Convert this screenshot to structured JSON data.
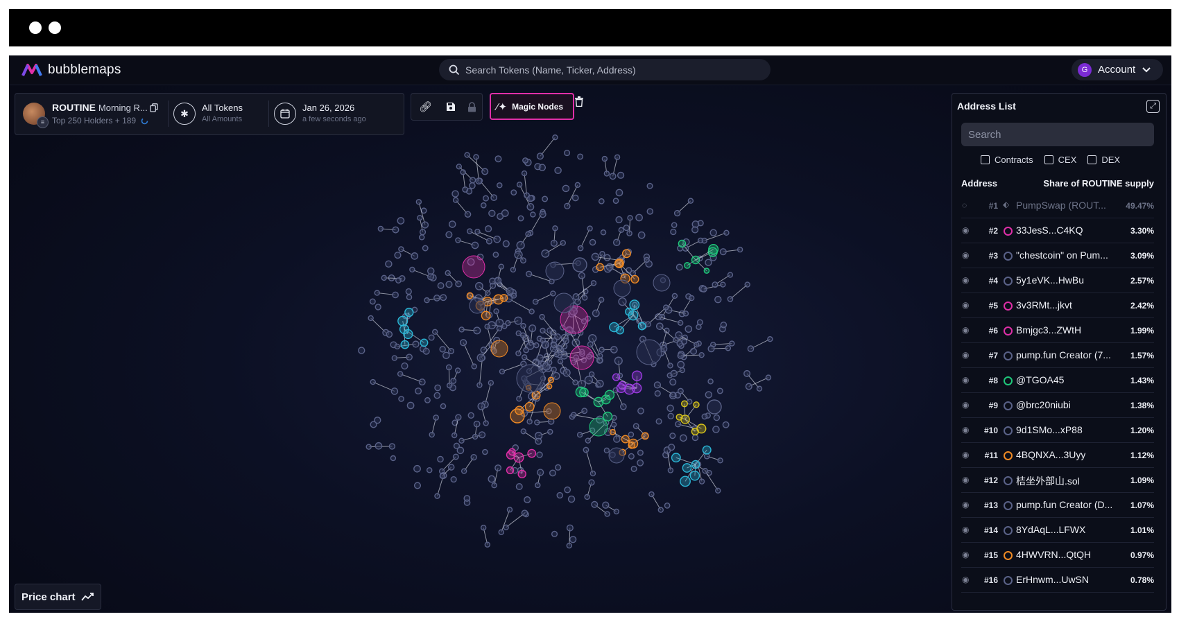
{
  "app": {
    "name": "bubblemaps"
  },
  "search": {
    "placeholder": "Search Tokens (Name, Ticker, Address)"
  },
  "account": {
    "avatar_letter": "G",
    "label": "Account"
  },
  "token": {
    "ticker": "ROUTINE",
    "name": "Morning R...",
    "holders": "Top 250 Holders + 189",
    "badge": "≡"
  },
  "filters_info": {
    "line1": "All Tokens",
    "line2": "All Amounts"
  },
  "date_info": {
    "line1": "Jan 26, 2026",
    "line2": "a few seconds ago"
  },
  "toolbar": {
    "magic_label": "Magic Nodes"
  },
  "address_list": {
    "title": "Address List",
    "search_placeholder": "Search",
    "filters": [
      "Contracts",
      "CEX",
      "DEX"
    ],
    "col_address": "Address",
    "col_share": "Share of ROUTINE supply",
    "rows": [
      {
        "rank": "#1",
        "name": "PumpSwap (ROUT...",
        "pct": "49.47%",
        "color": "#6d7388",
        "hidden": true
      },
      {
        "rank": "#2",
        "name": "33JesS...C4KQ",
        "pct": "3.30%",
        "color": "#e02fa8"
      },
      {
        "rank": "#3",
        "name": "\"chestcoin\" on Pum...",
        "pct": "3.09%",
        "color": "#5a6288"
      },
      {
        "rank": "#4",
        "name": "5y1eVK...HwBu",
        "pct": "2.57%",
        "color": "#5a6288"
      },
      {
        "rank": "#5",
        "name": "3v3RMt...jkvt",
        "pct": "2.42%",
        "color": "#e02fa8"
      },
      {
        "rank": "#6",
        "name": "Bmjgc3...ZWtH",
        "pct": "1.99%",
        "color": "#e02fa8"
      },
      {
        "rank": "#7",
        "name": "pump.fun Creator (7...",
        "pct": "1.57%",
        "color": "#5a6288"
      },
      {
        "rank": "#8",
        "name": "@TGOA45",
        "pct": "1.43%",
        "color": "#1fc77a"
      },
      {
        "rank": "#9",
        "name": "@brc20niubi",
        "pct": "1.38%",
        "color": "#5a6288"
      },
      {
        "rank": "#10",
        "name": "9d1SMo...xP88",
        "pct": "1.20%",
        "color": "#5a6288"
      },
      {
        "rank": "#11",
        "name": "4BQNXA...3Uyy",
        "pct": "1.12%",
        "color": "#f08a24"
      },
      {
        "rank": "#12",
        "name": "桔坐外部山.sol",
        "pct": "1.09%",
        "color": "#5a6288"
      },
      {
        "rank": "#13",
        "name": "pump.fun Creator (D...",
        "pct": "1.07%",
        "color": "#5a6288"
      },
      {
        "rank": "#14",
        "name": "8YdAqL...LFWX",
        "pct": "1.01%",
        "color": "#5a6288"
      },
      {
        "rank": "#15",
        "name": "4HWVRN...QtQH",
        "pct": "0.97%",
        "color": "#f08a24"
      },
      {
        "rank": "#16",
        "name": "ErHnwm...UwSN",
        "pct": "0.78%",
        "color": "#5a6288"
      }
    ]
  },
  "price_chart": {
    "label": "Price chart"
  },
  "icons": {
    "search": "search-icon",
    "chevron": "chevron-down-icon",
    "copy": "copy-icon",
    "link": "link-icon",
    "save": "save-icon",
    "lock": "lock-icon",
    "wand": "magic-wand-icon",
    "trash": "trash-icon",
    "eye": "eye-icon",
    "expand": "expand-icon",
    "trend": "trend-line-icon"
  },
  "colors": {
    "magenta": "#e02fa8",
    "orange": "#f08a24",
    "cyan": "#2bb6d6",
    "green": "#1fc77a",
    "purple": "#9b3be0",
    "yellow": "#d8c41a",
    "default_node": "#5a6288"
  }
}
